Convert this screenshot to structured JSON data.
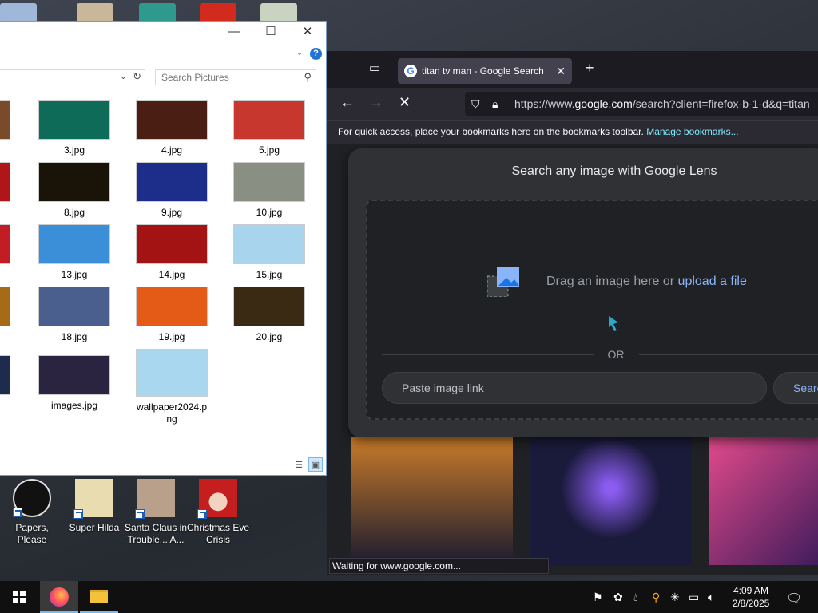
{
  "desktop": {
    "icons": [
      {
        "label": "Papers, Please"
      },
      {
        "label": "Super Hilda"
      },
      {
        "label": "Santa Claus in Trouble... A..."
      },
      {
        "label": "Christmas Eve Crisis"
      }
    ]
  },
  "explorer": {
    "controls": {
      "minimize": "—",
      "maximize": "☐",
      "close": "✕"
    },
    "help": "?",
    "search_placeholder": "Search Pictures",
    "files": [
      {
        "name": "3.jpg",
        "color": "#0d6b57"
      },
      {
        "name": "4.jpg",
        "color": "#4a1e12"
      },
      {
        "name": "5.jpg",
        "color": "#c8372d"
      },
      {
        "name": "8.jpg",
        "color": "#1a1408"
      },
      {
        "name": "9.jpg",
        "color": "#1c2d8a"
      },
      {
        "name": "10.jpg",
        "color": "#8a8f84"
      },
      {
        "name": "13.jpg",
        "color": "#3b8fd8"
      },
      {
        "name": "14.jpg",
        "color": "#a31313"
      },
      {
        "name": "15.jpg",
        "color": "#a9d4ee"
      },
      {
        "name": "18.jpg",
        "color": "#4a5f8e"
      },
      {
        "name": "19.jpg",
        "color": "#e35b16"
      },
      {
        "name": "20.jpg",
        "color": "#3a2a14"
      },
      {
        "name": "images.jpg",
        "color": "#2a2440"
      },
      {
        "name": "wallpaper2024.png",
        "color": "#a9d7f0"
      }
    ]
  },
  "browser": {
    "tab_title": "titan tv man - Google Search",
    "url_prefix": "https://www.",
    "url_domain": "google.com",
    "url_rest": "/search?client=firefox-b-1-d&q=titan",
    "bookmarks_text": "For quick access, place your bookmarks here on the bookmarks toolbar.",
    "bookmarks_link": "Manage bookmarks...",
    "lens": {
      "title": "Search any image with Google Lens",
      "drag_text": "Drag an image here or",
      "upload_link": "upload a file",
      "or": "OR",
      "paste_placeholder": "Paste image link",
      "search_button": "Search"
    },
    "status": "Waiting for www.google.com..."
  },
  "taskbar": {
    "time": "4:09 AM",
    "date": "2/8/2025"
  },
  "colors": {
    "accent": "#8ab4f8",
    "link": "#80ebff"
  }
}
